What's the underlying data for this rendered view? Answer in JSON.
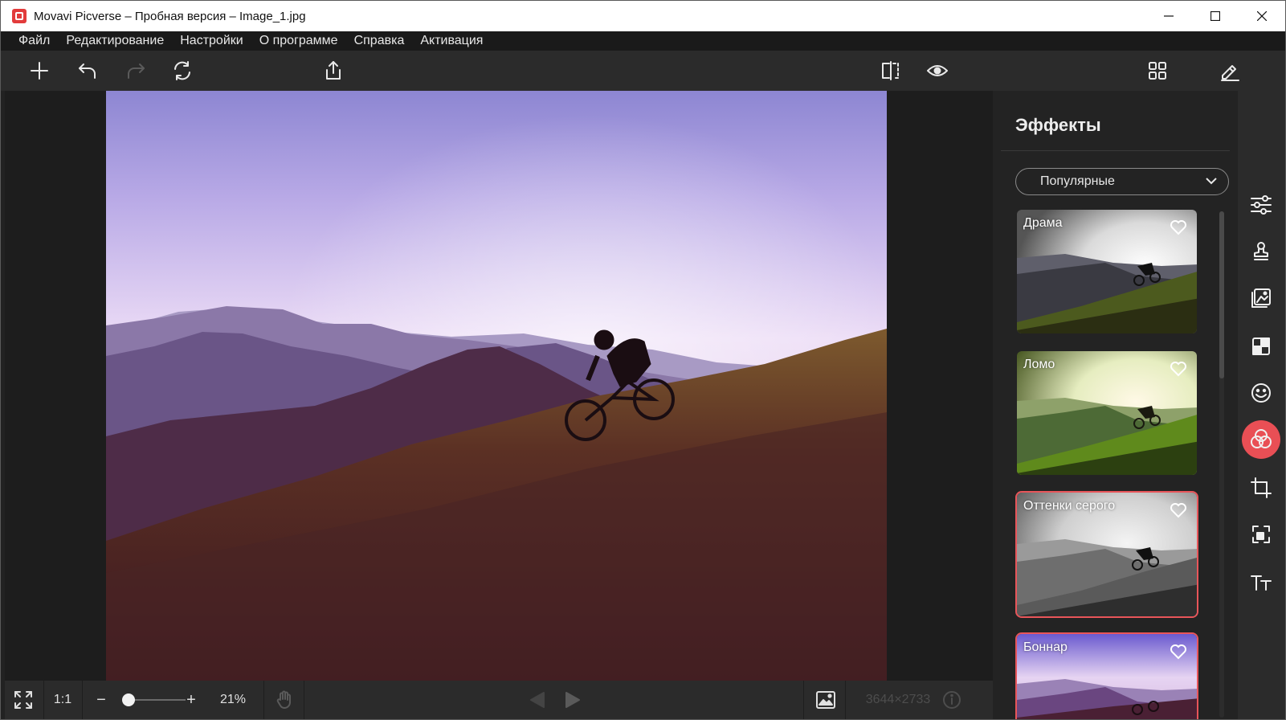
{
  "window": {
    "title": "Movavi Picverse – Пробная версия – Image_1.jpg",
    "minimize_label": "–",
    "maximize_label": "☐",
    "close_label": "✕"
  },
  "menu": {
    "items": [
      "Файл",
      "Редактирование",
      "Настройки",
      "О программе",
      "Справка",
      "Активация"
    ]
  },
  "toolbar": {
    "buttons": [
      "add-icon",
      "undo-icon",
      "redo-icon",
      "reset-icon",
      "export-icon",
      "compare-icon",
      "preview-icon",
      "grid-view-icon",
      "edit-icon"
    ]
  },
  "statusbar": {
    "actual_size_label": "1:1",
    "zoom_minus": "−",
    "zoom_plus": "+",
    "zoom_value": "21%",
    "image_dimensions": "3644×2733"
  },
  "panel": {
    "title": "Эффекты",
    "category": "Популярные",
    "effects": [
      {
        "name": "Драма",
        "selected": false
      },
      {
        "name": "Ломо",
        "selected": false
      },
      {
        "name": "Оттенки серого",
        "selected": true
      },
      {
        "name": "Боннар",
        "selected": false
      }
    ]
  },
  "rail": {
    "tools": [
      "adjust-icon",
      "stamp-icon",
      "background-icon",
      "mosaic-icon",
      "sticker-icon",
      "effects-icon",
      "crop-icon",
      "resize-icon",
      "text-icon"
    ],
    "active_tool": "effects-icon"
  },
  "colors": {
    "accent": "#e94f55",
    "panel_bg": "#232323",
    "toolbar_bg": "#2b2b2b"
  }
}
